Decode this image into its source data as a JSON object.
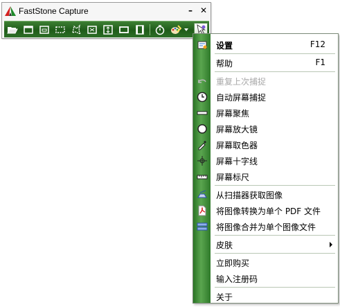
{
  "window": {
    "title": "FastStone Capture",
    "minimize_glyph": "–",
    "close_glyph": "✕"
  },
  "toolbar": {
    "tools": [
      {
        "name": "open-file-icon"
      },
      {
        "name": "capture-active-window-icon"
      },
      {
        "name": "capture-window-object-icon"
      },
      {
        "name": "capture-rectangle-icon"
      },
      {
        "name": "capture-freehand-icon"
      },
      {
        "name": "capture-full-screen-icon"
      },
      {
        "name": "capture-scrolling-window-icon"
      },
      {
        "name": "capture-fixed-region-icon"
      },
      {
        "name": "screen-recorder-icon"
      },
      {
        "name": "delay-timer-icon"
      },
      {
        "name": "output-destination-icon"
      },
      {
        "name": "settings-menu-icon"
      }
    ]
  },
  "menu": {
    "items": [
      {
        "label": "设置",
        "shortcut": "F12",
        "icon": "settings-icon",
        "bold": true
      },
      {
        "label": "帮助",
        "shortcut": "F1",
        "icon": ""
      },
      {
        "label": "重复上次捕捉",
        "shortcut": "",
        "icon": "repeat-icon",
        "disabled": true
      },
      {
        "label": "自动屏幕捕捉",
        "shortcut": "",
        "icon": "clock-icon"
      },
      {
        "label": "屏幕聚焦",
        "shortcut": "",
        "icon": "spotlight-icon"
      },
      {
        "label": "屏幕放大镜",
        "shortcut": "",
        "icon": "magnifier-icon"
      },
      {
        "label": "屏幕取色器",
        "shortcut": "",
        "icon": "color-picker-icon"
      },
      {
        "label": "屏幕十字线",
        "shortcut": "",
        "icon": "crosshair-icon"
      },
      {
        "label": "屏幕标尺",
        "shortcut": "",
        "icon": "ruler-icon"
      },
      {
        "label": "从扫描器获取图像",
        "shortcut": "",
        "icon": "scanner-icon"
      },
      {
        "label": "将图像转换为单个 PDF 文件",
        "shortcut": "",
        "icon": "pdf-icon"
      },
      {
        "label": "将图像合并为单个图像文件",
        "shortcut": "",
        "icon": "combine-images-icon"
      },
      {
        "label": "皮肤",
        "shortcut": "",
        "icon": "",
        "submenu": true
      },
      {
        "label": "立即购买",
        "shortcut": "",
        "icon": ""
      },
      {
        "label": "输入注册码",
        "shortcut": "",
        "icon": ""
      },
      {
        "label": "关于",
        "shortcut": "",
        "icon": ""
      }
    ]
  },
  "colors": {
    "toolbar_green": "#2d6e27",
    "menu_strip_green": "#3d8d35",
    "disabled_text": "#a8a8a8"
  }
}
